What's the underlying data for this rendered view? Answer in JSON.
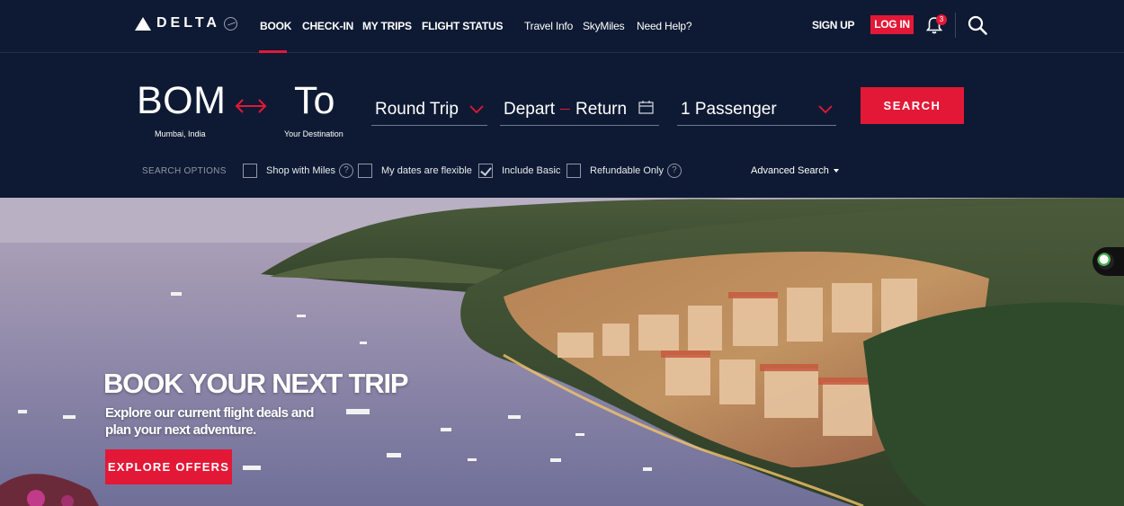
{
  "brand": {
    "name": "DELTA"
  },
  "nav": {
    "items": [
      {
        "label": "BOOK",
        "active": true
      },
      {
        "label": "CHECK-IN"
      },
      {
        "label": "MY TRIPS"
      },
      {
        "label": "FLIGHT STATUS"
      }
    ],
    "secondary": [
      {
        "label": "Travel Info"
      },
      {
        "label": "SkyMiles"
      },
      {
        "label": "Need Help?"
      }
    ],
    "signup_label": "SIGN UP",
    "login_label": "LOG IN",
    "notification_count": "3"
  },
  "booking": {
    "origin": {
      "code": "BOM",
      "city": "Mumbai, India"
    },
    "destination": {
      "code": "To",
      "city": "Your Destination"
    },
    "trip_type": "Round Trip",
    "depart_label": "Depart",
    "return_label": "Return",
    "passengers": "1 Passenger",
    "search_label": "SEARCH",
    "search_options_label": "SEARCH OPTIONS",
    "options": [
      {
        "label": "Shop with Miles",
        "checked": false,
        "help": true
      },
      {
        "label": "My dates are flexible",
        "checked": false,
        "help": false
      },
      {
        "label": "Include Basic",
        "checked": true,
        "help": false
      },
      {
        "label": "Refundable Only",
        "checked": false,
        "help": true
      }
    ],
    "advanced_label": "Advanced Search"
  },
  "hero": {
    "title": "BOOK YOUR NEXT TRIP",
    "subtitle": "Explore our current flight deals and plan your next adventure.",
    "cta_label": "EXPLORE OFFERS"
  },
  "colors": {
    "brand_red": "#e31837",
    "navy": "#0e1a33"
  }
}
